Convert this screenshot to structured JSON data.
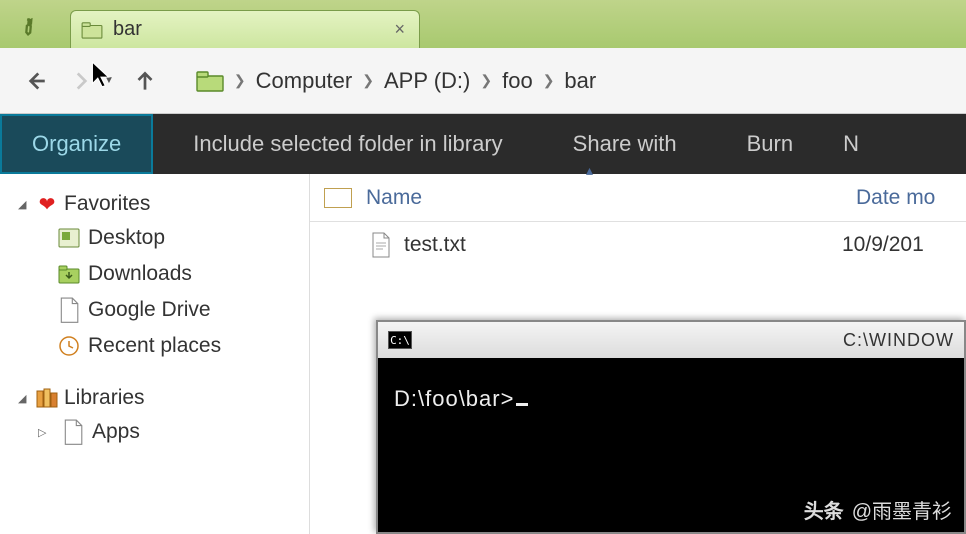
{
  "tab": {
    "label": "bar"
  },
  "breadcrumb": {
    "items": [
      "Computer",
      "APP (D:)",
      "foo",
      "bar"
    ]
  },
  "toolbar": {
    "organize": "Organize",
    "include": "Include selected folder in library",
    "share": "Share with",
    "burn": "Burn",
    "overflow": "N"
  },
  "sidebar": {
    "favorites": {
      "label": "Favorites",
      "items": [
        {
          "label": "Desktop"
        },
        {
          "label": "Downloads"
        },
        {
          "label": "Google Drive"
        },
        {
          "label": "Recent places"
        }
      ]
    },
    "libraries": {
      "label": "Libraries",
      "items": [
        {
          "label": "Apps"
        }
      ]
    }
  },
  "filelist": {
    "columns": {
      "name": "Name",
      "date": "Date mo"
    },
    "rows": [
      {
        "name": "test.txt",
        "date": "10/9/201"
      }
    ]
  },
  "terminal": {
    "title_icon": "C:\\",
    "title_path": "C:\\WINDOW",
    "prompt": "D:\\foo\\bar>"
  },
  "watermark": {
    "brand": "头条",
    "author": "@雨墨青衫"
  }
}
